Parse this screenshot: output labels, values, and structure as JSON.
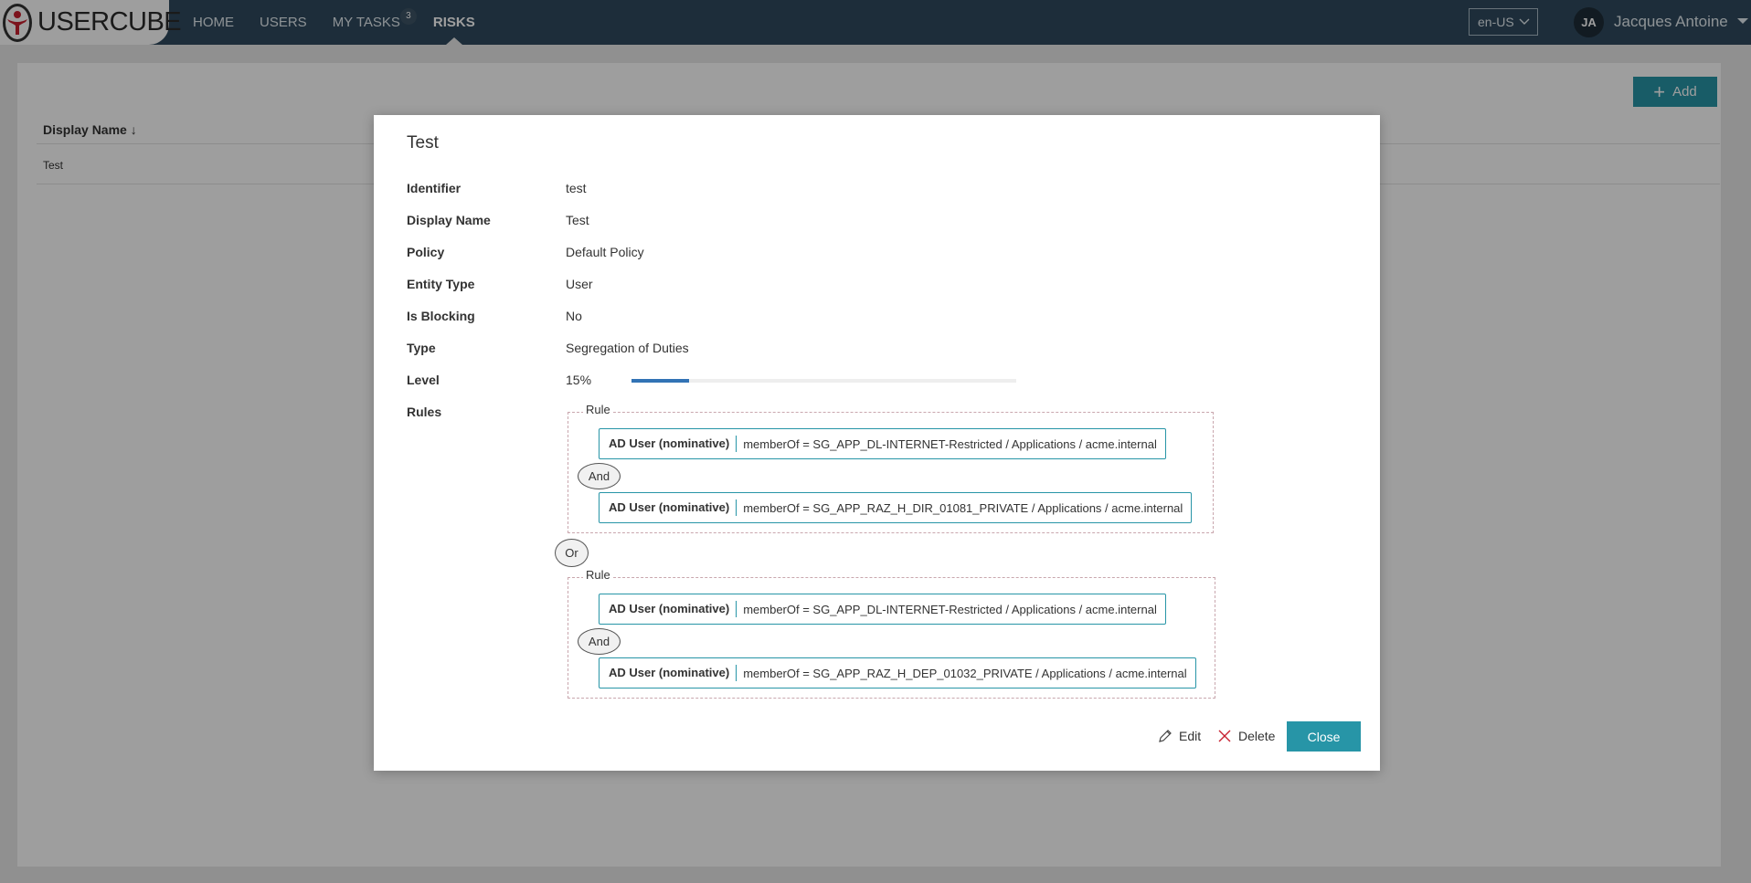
{
  "app": {
    "logo_text": "USERCUBE"
  },
  "nav": {
    "items": [
      {
        "label": "HOME"
      },
      {
        "label": "USERS"
      },
      {
        "label": "MY TASKS",
        "badge": "3"
      },
      {
        "label": "RISKS",
        "active": true
      }
    ]
  },
  "locale": {
    "value": "en-US"
  },
  "user": {
    "initials": "JA",
    "name": "Jacques Antoine"
  },
  "page": {
    "add_label": "Add",
    "column_header": "Display Name ↓",
    "rows": [
      {
        "display_name": "Test"
      }
    ]
  },
  "modal": {
    "title": "Test",
    "fields": {
      "identifier": {
        "label": "Identifier",
        "value": "test"
      },
      "display_name": {
        "label": "Display Name",
        "value": "Test"
      },
      "policy": {
        "label": "Policy",
        "value": "Default Policy"
      },
      "entity_type": {
        "label": "Entity Type",
        "value": "User"
      },
      "is_blocking": {
        "label": "Is Blocking",
        "value": "No"
      },
      "type": {
        "label": "Type",
        "value": "Segregation of Duties"
      },
      "level": {
        "label": "Level",
        "value": "15%",
        "fraction": 0.15
      },
      "rules": {
        "label": "Rules"
      }
    },
    "rules": [
      {
        "legend": "Rule",
        "conditions": [
          {
            "entity": "AD User (nominative)",
            "expression": "memberOf = SG_APP_DL-INTERNET-Restricted / Applications / acme.internal"
          },
          {
            "entity": "AD User (nominative)",
            "expression": "memberOf = SG_APP_RAZ_H_DIR_01081_PRIVATE / Applications / acme.internal"
          }
        ],
        "operator": "And"
      },
      {
        "legend": "Rule",
        "conditions": [
          {
            "entity": "AD User (nominative)",
            "expression": "memberOf = SG_APP_DL-INTERNET-Restricted / Applications / acme.internal"
          },
          {
            "entity": "AD User (nominative)",
            "expression": "memberOf = SG_APP_RAZ_H_DEP_01032_PRIVATE / Applications / acme.internal"
          }
        ],
        "operator": "And"
      }
    ],
    "between_rules_operator": "Or",
    "actions": {
      "edit": "Edit",
      "delete": "Delete",
      "close": "Close"
    }
  },
  "colors": {
    "accent": "#2795a7",
    "topbar": "#2f4a5e",
    "level": "#3273b5"
  }
}
